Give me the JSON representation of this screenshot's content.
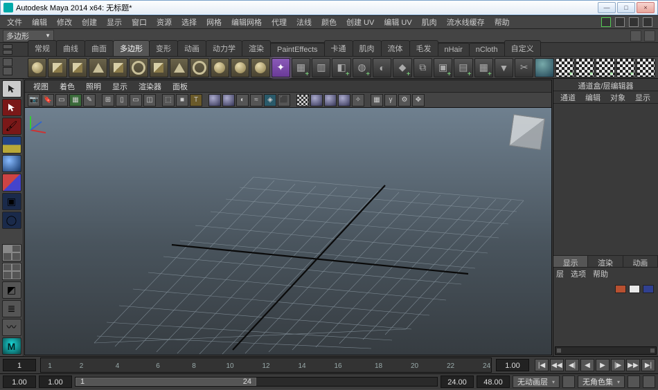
{
  "title": "Autodesk Maya 2014 x64: 无标题*",
  "menu": [
    "文件",
    "编辑",
    "修改",
    "创建",
    "显示",
    "窗口",
    "资源",
    "选择",
    "网格",
    "编辑网格",
    "代理",
    "法线",
    "颜色",
    "创建 UV",
    "编辑 UV",
    "肌肉",
    "流水线缓存",
    "帮助"
  ],
  "module_dropdown": "多边形",
  "shelf_tabs": [
    "常规",
    "曲线",
    "曲面",
    "多边形",
    "变形",
    "动画",
    "动力学",
    "渲染",
    "PaintEffects",
    "卡通",
    "肌肉",
    "流体",
    "毛发",
    "nHair",
    "nCloth",
    "自定义"
  ],
  "shelf_active": 3,
  "viewport_menu": [
    "视图",
    "着色",
    "照明",
    "显示",
    "渲染器",
    "面板"
  ],
  "channel_title": "通道盒/层编辑器",
  "channel_menu": [
    "通道",
    "编辑",
    "对象",
    "显示"
  ],
  "layer_tabs": [
    "显示",
    "渲染",
    "动画"
  ],
  "layer_menu": [
    "层",
    "选项",
    "帮助"
  ],
  "swatch_colors": [
    "#b85030",
    "#e8e8e8",
    "#304090"
  ],
  "timeline_labels": [
    "1",
    "2",
    "4",
    "6",
    "8",
    "10",
    "12",
    "14",
    "16",
    "18",
    "20",
    "22",
    "24"
  ],
  "timeline_positions": [
    2,
    9,
    17,
    26,
    34,
    42,
    50,
    58,
    66,
    75,
    83,
    91,
    99
  ],
  "current_frame": "1.00",
  "range_start_outer": "1.00",
  "range_start_inner": "1.00",
  "range_end_inner": "24.00",
  "range_end_outer": "48.00",
  "slider_labels": {
    "start": "1",
    "end": "24"
  },
  "anim_layer_dd": "无动画层",
  "char_set_dd": "无角色集",
  "play_icons": [
    "|◀",
    "◀◀",
    "◀|",
    "◀",
    "▶",
    "|▶",
    "▶▶",
    "▶|"
  ]
}
